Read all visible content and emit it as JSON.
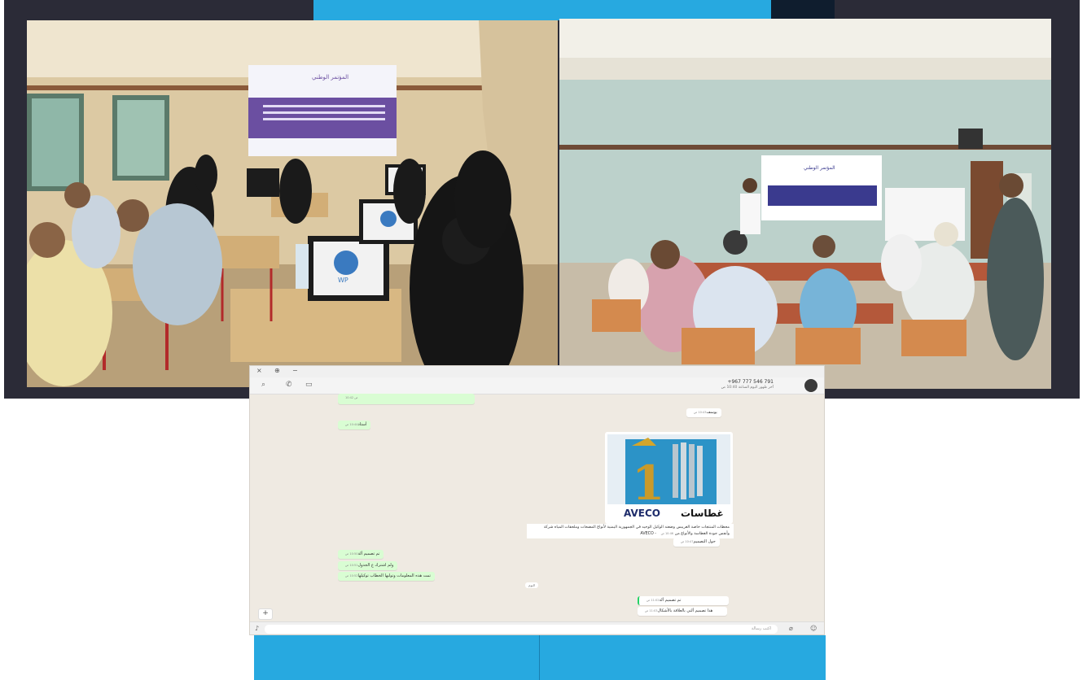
{
  "chat": {
    "contact_number": "+967 777 546 791",
    "contact_status": "آخر ظهور اليوم الساعة 10:40 ص",
    "window_controls": [
      "×",
      "⊕",
      "−"
    ],
    "messages": [
      {
        "dir": "out",
        "text": "",
        "time": "10:42 ص"
      },
      {
        "dir": "in",
        "text": "يوسف",
        "time": "10:43 ص"
      },
      {
        "dir": "out",
        "text": "أستاذ",
        "time": "10:44 ص"
      },
      {
        "dir": "in",
        "text": "حول التصميم",
        "time": "10:47 ص"
      },
      {
        "dir": "out",
        "text": "تم تصميم ألة",
        "time": "10:50 ص"
      },
      {
        "dir": "out",
        "text": "ولم اشترك ع الجدول",
        "time": "10:51 ص"
      },
      {
        "dir": "out",
        "text": "تمت هذه المعلومات وتوليها الخطاب توكيلها",
        "time": "10:52 ص"
      },
      {
        "dir": "in",
        "text": "تم تصميم ألة",
        "time": "11:02 ص"
      },
      {
        "dir": "in",
        "text": "هذا تصميم ألتي بالعلاقة بالأشكال",
        "time": "11:03 ص"
      }
    ],
    "image_caption": "محطات المنتجات خاصة الغريبس وضعنه الوكيل الوحيد في الجمهورية اليمنية لأنواع المضخات وملحقات المياه شركة AVECO - وأنفس جودة الغطاسة والأنواع من",
    "image_caption_time": "10:46 ص",
    "image_logo_text": "AVECO",
    "image_arabic_text": "غطاسات",
    "image_number": "1",
    "date_chip": "اليوم",
    "composer_placeholder": "اكتب رسالة",
    "plus_label": "+"
  },
  "photos": {
    "left_banner_title": "المؤتمر الوطني",
    "left_laptop_logo": "WP",
    "right_banner_title": "المؤتمر الوطني"
  },
  "colors": {
    "accent_blue": "#27a9e0",
    "dark_band": "#2b2b37",
    "chat_bg": "#efeae2",
    "bubble_out": "#d9fdd3"
  }
}
